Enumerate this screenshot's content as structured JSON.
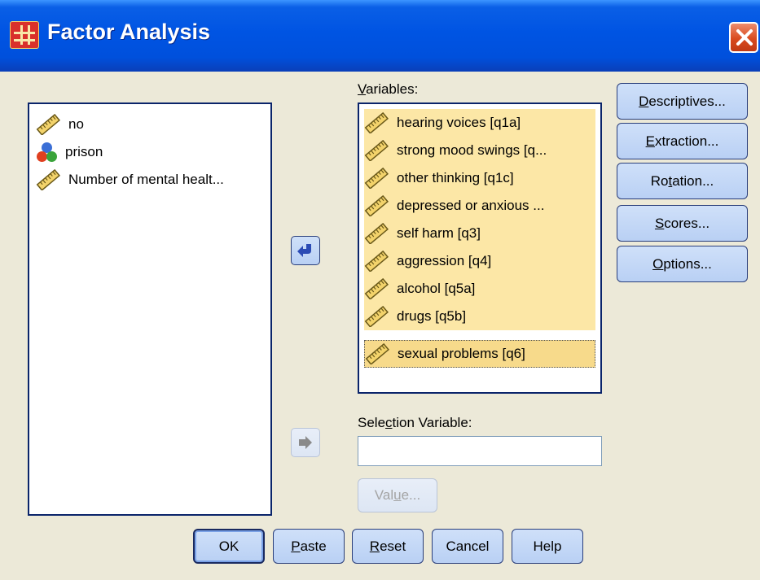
{
  "window": {
    "title": "Factor Analysis",
    "accent": "#0054e3"
  },
  "source_list": {
    "items": [
      {
        "label": "no",
        "icon": "ruler-scale-icon"
      },
      {
        "label": "prison",
        "icon": "nominal-icon"
      },
      {
        "label": "Number of mental healt...",
        "icon": "ruler-scale-icon"
      }
    ]
  },
  "variables": {
    "label_prefix": "",
    "label_mnemonic": "V",
    "label_rest": "ariables:",
    "items": [
      "hearing voices  [q1a]",
      "strong mood swings [q...",
      "other thinking [q1c]",
      "depressed or anxious ...",
      "self harm [q3]",
      "aggression [q4]",
      "alcohol [q5a]",
      "drugs [q5b]",
      "sexual problems [q6]"
    ],
    "highlight_color": "#fce7a6"
  },
  "selection_variable": {
    "label_prefix": "Sele",
    "label_mnemonic": "c",
    "label_rest": "tion Variable:",
    "value": ""
  },
  "side_buttons": {
    "descriptives": {
      "pre": "",
      "mn": "D",
      "post": "escriptives..."
    },
    "extraction": {
      "pre": "",
      "mn": "E",
      "post": "xtraction..."
    },
    "rotation": {
      "pre": "Ro",
      "mn": "t",
      "post": "ation..."
    },
    "scores": {
      "pre": "",
      "mn": "S",
      "post": "cores..."
    },
    "options": {
      "pre": "",
      "mn": "O",
      "post": "ptions..."
    }
  },
  "value_button": {
    "pre": "Val",
    "mn": "u",
    "post": "e..."
  },
  "bottom_buttons": {
    "ok": "OK",
    "paste": {
      "pre": "",
      "mn": "P",
      "post": "aste"
    },
    "reset": {
      "pre": "",
      "mn": "R",
      "post": "eset"
    },
    "cancel": "Cancel",
    "help": "Help"
  }
}
